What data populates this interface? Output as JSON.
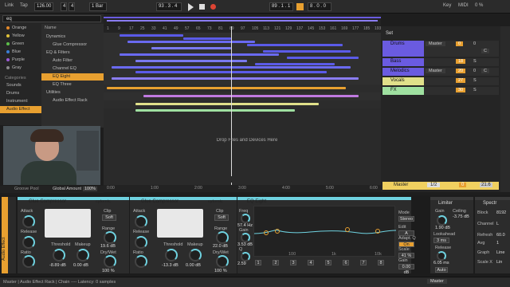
{
  "transport": {
    "link": "Link",
    "tap": "Tap",
    "tempo": "126.00",
    "sig_num": "4",
    "sig_den": "4",
    "quant": "1 Bar",
    "pos": "93 . 3 . 4",
    "loop_pos": "89 . 1 . 1",
    "loop_len": "8 . 0 . 0",
    "key": "Key",
    "midi": "MIDI",
    "cpu": "0 %"
  },
  "browser": {
    "search_value": "eq",
    "collections": [
      {
        "label": "Orange",
        "color": "#e58a2a"
      },
      {
        "label": "Yellow",
        "color": "#e0c23a"
      },
      {
        "label": "Green",
        "color": "#5cbf4a"
      },
      {
        "label": "Blue",
        "color": "#3b7fd6"
      },
      {
        "label": "Purple",
        "color": "#9b5ad6"
      },
      {
        "label": "Gray",
        "color": "#8a8a8a"
      }
    ],
    "categories_heading": "Categories",
    "categories": [
      "Sounds",
      "Drums",
      "Instrument:",
      "Audio Effect"
    ],
    "name_header": "Name",
    "items": [
      "Dynamics",
      "Glue Compressor",
      "EQ & Filters",
      "Auto Filter",
      "Channel EQ",
      "EQ Eight",
      "EQ Three",
      "Utilities",
      "Audio Effect Rack"
    ],
    "selected_item": "EQ Eight",
    "footer_left": "Groove Pool",
    "footer_right": "Global Amount",
    "footer_amount": "100%"
  },
  "arrangement": {
    "ruler": [
      "1",
      "9",
      "17",
      "25",
      "33",
      "41",
      "49",
      "57",
      "65",
      "73",
      "81",
      "89",
      "97",
      "105",
      "113",
      "121",
      "129",
      "137",
      "145",
      "153",
      "161",
      "169",
      "177",
      "185",
      "193"
    ],
    "drop_text": "Drop Files and Devices Here",
    "time_ruler": [
      "0:00",
      "1:00",
      "2:00",
      "3:00",
      "4:00",
      "5:00",
      "6:00"
    ]
  },
  "mixer": {
    "set_label": "Set",
    "tracks": [
      {
        "name": "Drums",
        "color": "#6a5be0",
        "routing": "Master",
        "vol": "0",
        "pan": "C",
        "num": "1",
        "num2": "0"
      },
      {
        "name": "Bass",
        "color": "#6a5be0",
        "routing": "",
        "vol": "18",
        "pan": "",
        "num": "",
        "num2": "S"
      },
      {
        "name": "Melodics",
        "color": "#6a5be0",
        "routing": "Master",
        "vol": "20",
        "pan": "C",
        "num": "",
        "num2": "0"
      },
      {
        "name": "Vocals",
        "color": "#e0e08a",
        "routing": "",
        "vol": "27",
        "pan": "",
        "num": "",
        "num2": "S"
      },
      {
        "name": "FX",
        "color": "#9fe0a0",
        "routing": "",
        "vol": "30",
        "pan": "",
        "num": "",
        "num2": "S"
      }
    ],
    "master_name": "Master",
    "master_routing": "1/2",
    "master_vol": "0",
    "master_pan": "21.6"
  },
  "devices": {
    "rack_label": "Audio Effect",
    "glue1": {
      "title": "Glue Compressor",
      "brand": "cytomic",
      "attack": "Attack",
      "clip": "Clip",
      "soft": "Soft",
      "release": "Release",
      "ratio": "Ratio",
      "threshold": "Threshold",
      "threshold_val": "-8.89 dB",
      "makeup": "Makeup",
      "makeup_val": "0.00 dB",
      "range": "Range",
      "range_val": "19.6 dB",
      "drywet": "Dry/Wet",
      "drywet_val": "100 %"
    },
    "glue2": {
      "title": "Glue Compressor",
      "brand": "cytomic",
      "attack": "Attack",
      "clip": "Clip",
      "soft": "Soft",
      "release": "Release",
      "ratio": "Ratio",
      "threshold": "Threshold",
      "threshold_val": "-13.3 dB",
      "makeup": "Makeup",
      "makeup_val": "0.00 dB",
      "range": "Range",
      "range_val": "22.0 dB",
      "drywet": "Dry/Wet",
      "drywet_val": "100 %"
    },
    "eq": {
      "title": "EQ Eight",
      "freq": "Freq",
      "freq_val": "57.4 Hz",
      "gain": "Gain",
      "gain_val": "3.53 dB",
      "q": "Q",
      "q_val": "2.59",
      "mode": "Mode",
      "mode_val": "Stereo",
      "edit": "Edit",
      "edit_val": "A",
      "adapt": "Adapt. Q",
      "on": "On",
      "scale": "Scale",
      "scale_val": "41 %",
      "out_gain": "Gain",
      "out_gain_val": "0.00 dB",
      "freq_labels": [
        "100",
        "1k",
        "10k"
      ],
      "bands": [
        "1",
        "2",
        "3",
        "4",
        "5",
        "6",
        "7",
        "8"
      ]
    },
    "limiter": {
      "title": "Limiter",
      "gain": "Gain",
      "gain_val": "1.90 dB",
      "ceiling": "Ceiling",
      "ceiling_val": "-3.75 dB",
      "lookahead": "Lookahead",
      "lookahead_val": "3 ms",
      "release": "Release",
      "release_val": "6.05 ms",
      "auto": "Auto"
    },
    "spectrum": {
      "title": "Spectr",
      "block": "Block",
      "block_val": "8192",
      "channel": "Channel",
      "channel_val": "L",
      "refresh": "Refresh",
      "refresh_val": "60.0",
      "avg": "Avg",
      "avg_val": "1",
      "graph": "Graph",
      "graph_val": "Line",
      "scale_x": "Scale X",
      "scale_x_val": "Lin"
    }
  },
  "status": {
    "text": "Master | Audio Effect Rack | Chain ---- Latency: 0 samples",
    "master": "Master"
  }
}
